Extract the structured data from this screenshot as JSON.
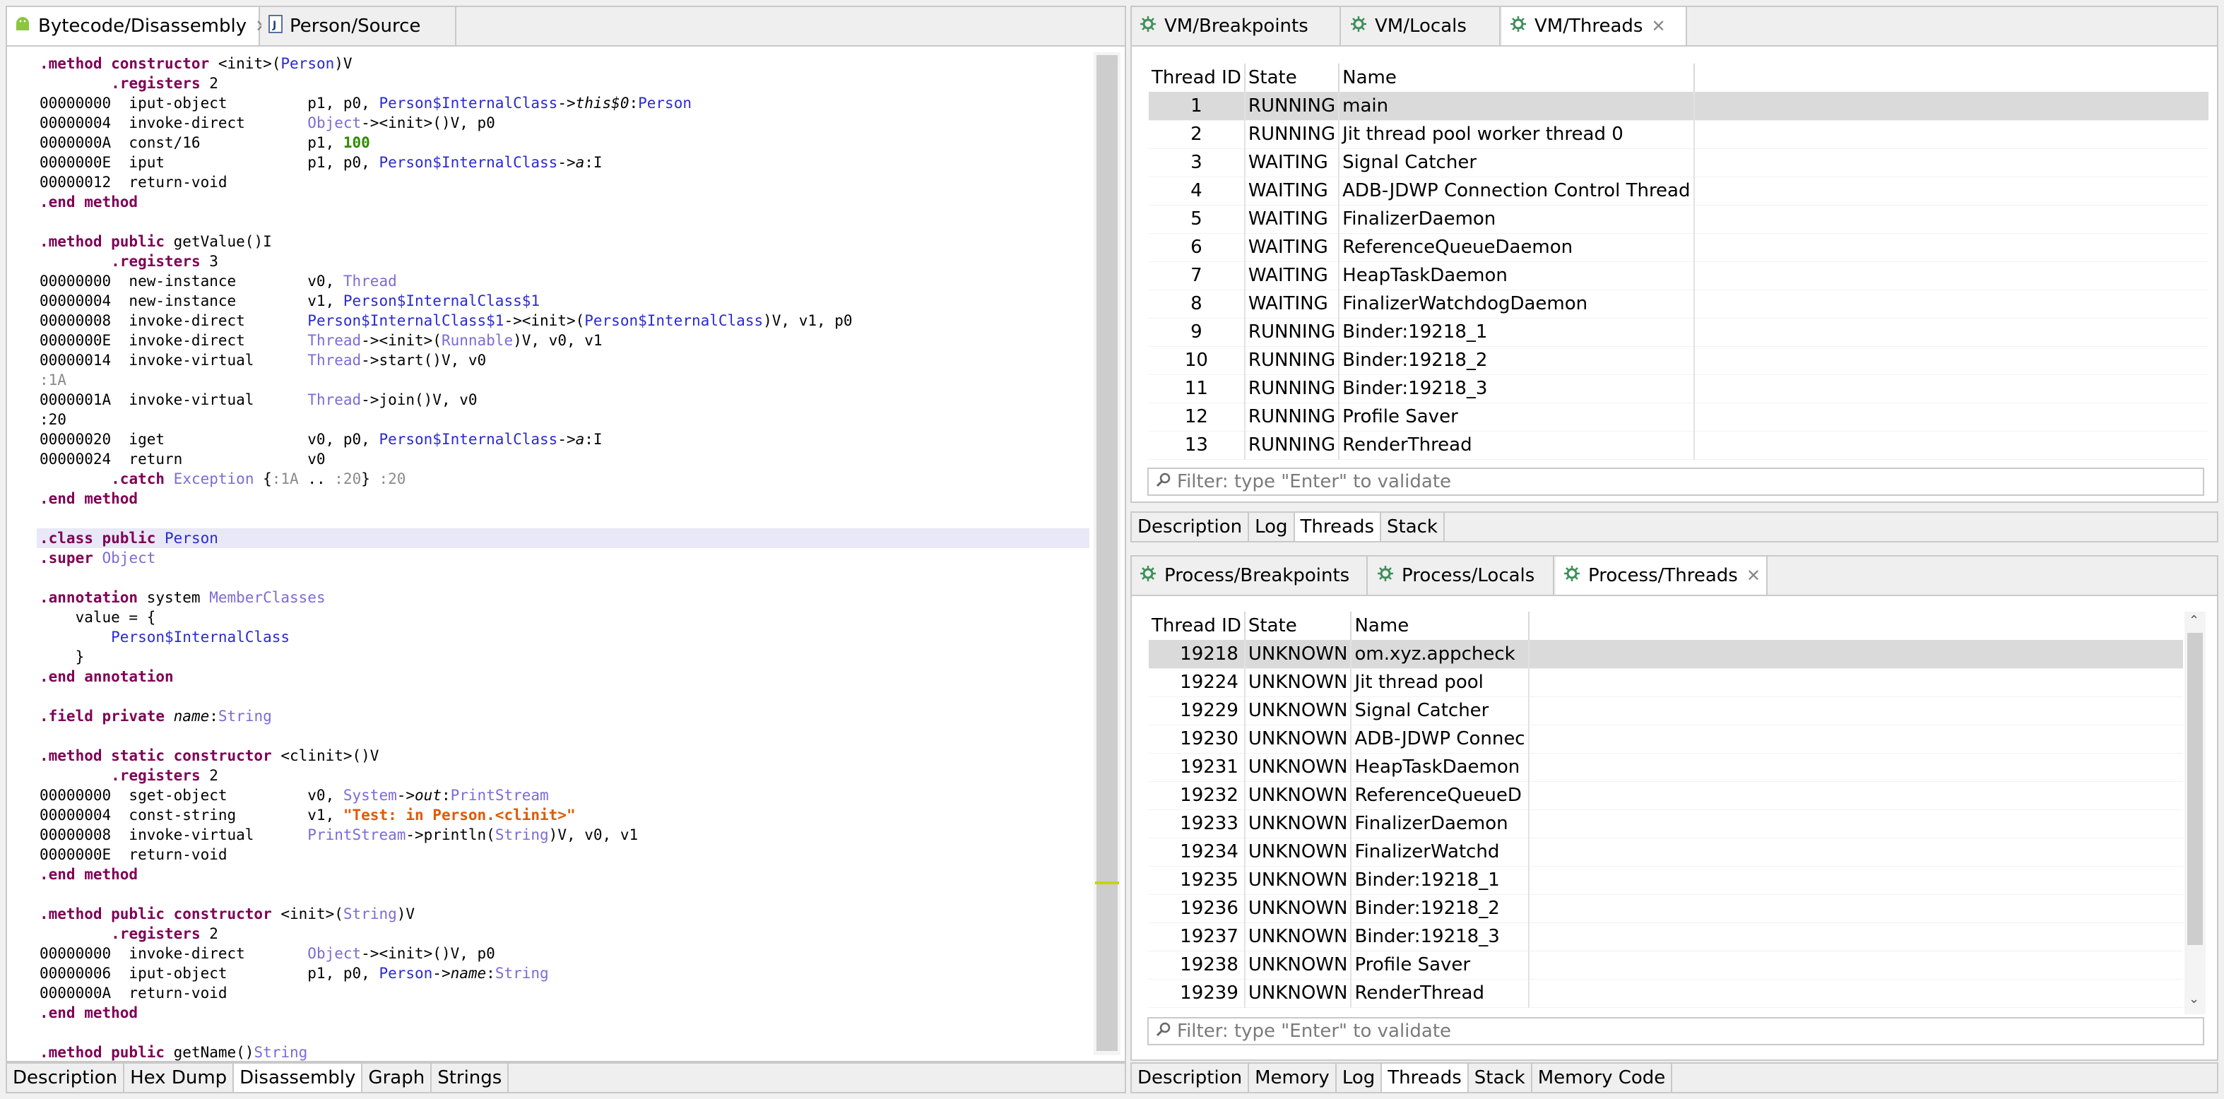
{
  "left": {
    "tabs": [
      {
        "label": "Bytecode/Disassembly",
        "active": true,
        "closable": true,
        "icon": "android-icon"
      },
      {
        "label": "Person/Source",
        "active": false,
        "closable": false,
        "icon": "java-file-icon"
      }
    ],
    "bottom_tabs": [
      "Description",
      "Hex Dump",
      "Disassembly",
      "Graph",
      "Strings"
    ],
    "code_lines": [
      [
        [
          "kw",
          ".method constructor "
        ],
        [
          "",
          "<init>("
        ],
        [
          "ty",
          "Person"
        ],
        [
          "",
          ")V"
        ]
      ],
      [
        [
          "",
          "        "
        ],
        [
          "kw",
          ".registers"
        ],
        [
          "",
          " 2"
        ]
      ],
      [
        [
          "",
          "00000000  iput-object         p1, p0, "
        ],
        [
          "ty",
          "Person$InternalClass"
        ],
        [
          "",
          "->"
        ],
        [
          "it",
          "this$0"
        ],
        [
          "",
          ":"
        ],
        [
          "ty",
          "Person"
        ]
      ],
      [
        [
          "",
          "00000004  invoke-direct       "
        ],
        [
          "tl",
          "Object"
        ],
        [
          "",
          "-><init>()V, p0"
        ]
      ],
      [
        [
          "",
          "0000000A  const/16            p1, "
        ],
        [
          "num",
          "100"
        ]
      ],
      [
        [
          "",
          "0000000E  iput                p1, p0, "
        ],
        [
          "ty",
          "Person$InternalClass"
        ],
        [
          "",
          "->"
        ],
        [
          "it",
          "a"
        ],
        [
          "",
          ":I"
        ]
      ],
      [
        [
          "",
          "00000012  return-void"
        ]
      ],
      [
        [
          "kw",
          ".end method"
        ]
      ],
      [
        [
          "",
          ""
        ]
      ],
      [
        [
          "kw",
          ".method public "
        ],
        [
          "",
          "getValue()I"
        ]
      ],
      [
        [
          "",
          "        "
        ],
        [
          "kw",
          ".registers"
        ],
        [
          "",
          " 3"
        ]
      ],
      [
        [
          "",
          "00000000  new-instance        v0, "
        ],
        [
          "tl",
          "Thread"
        ]
      ],
      [
        [
          "",
          "00000004  new-instance        v1, "
        ],
        [
          "ty",
          "Person$InternalClass$1"
        ]
      ],
      [
        [
          "",
          "00000008  invoke-direct       "
        ],
        [
          "ty",
          "Person$InternalClass$1"
        ],
        [
          "",
          "-><init>("
        ],
        [
          "ty",
          "Person$InternalClass"
        ],
        [
          "",
          ")V, v1, p0"
        ]
      ],
      [
        [
          "",
          "0000000E  invoke-direct       "
        ],
        [
          "tl",
          "Thread"
        ],
        [
          "",
          "-><init>("
        ],
        [
          "tl",
          "Runnable"
        ],
        [
          "",
          ")V, v0, v1"
        ]
      ],
      [
        [
          "",
          "00000014  invoke-virtual      "
        ],
        [
          "tl",
          "Thread"
        ],
        [
          "",
          "->start()V, v0"
        ]
      ],
      [
        [
          "gry",
          ":1A"
        ]
      ],
      [
        [
          "",
          "0000001A  invoke-virtual      "
        ],
        [
          "tl",
          "Thread"
        ],
        [
          "",
          "->join()V, v0"
        ]
      ],
      [
        [
          "",
          ":20"
        ]
      ],
      [
        [
          "",
          "00000020  iget                v0, p0, "
        ],
        [
          "ty",
          "Person$InternalClass"
        ],
        [
          "",
          "->"
        ],
        [
          "it",
          "a"
        ],
        [
          "",
          ":I"
        ]
      ],
      [
        [
          "",
          "00000024  return              v0"
        ]
      ],
      [
        [
          "",
          "        "
        ],
        [
          "kw",
          ".catch"
        ],
        [
          "",
          " "
        ],
        [
          "tl",
          "Exception"
        ],
        [
          "",
          " {"
        ],
        [
          "gry",
          ":1A"
        ],
        [
          "",
          " .. "
        ],
        [
          "gry",
          ":20"
        ],
        [
          "",
          "} "
        ],
        [
          "gry",
          ":20"
        ]
      ],
      [
        [
          "kw",
          ".end method"
        ]
      ],
      [
        [
          "",
          ""
        ]
      ],
      [
        [
          "kw",
          ".class public "
        ],
        [
          "ty",
          "Person"
        ]
      ],
      [
        [
          "kw",
          ".super "
        ],
        [
          "tl",
          "Object"
        ]
      ],
      [
        [
          "",
          ""
        ]
      ],
      [
        [
          "kw",
          ".annotation"
        ],
        [
          "",
          " system "
        ],
        [
          "tl",
          "MemberClasses"
        ]
      ],
      [
        [
          "",
          "    value = {"
        ]
      ],
      [
        [
          "",
          "        "
        ],
        [
          "ty",
          "Person$InternalClass"
        ]
      ],
      [
        [
          "",
          "    }"
        ]
      ],
      [
        [
          "kw",
          ".end annotation"
        ]
      ],
      [
        [
          "",
          ""
        ]
      ],
      [
        [
          "kw",
          ".field private "
        ],
        [
          "it",
          "name"
        ],
        [
          "",
          ":"
        ],
        [
          "tl",
          "String"
        ]
      ],
      [
        [
          "",
          ""
        ]
      ],
      [
        [
          "kw",
          ".method static constructor "
        ],
        [
          "",
          "<clinit>()V"
        ]
      ],
      [
        [
          "",
          "        "
        ],
        [
          "kw",
          ".registers"
        ],
        [
          "",
          " 2"
        ]
      ],
      [
        [
          "",
          "00000000  sget-object         v0, "
        ],
        [
          "tl",
          "System"
        ],
        [
          "",
          "->"
        ],
        [
          "it",
          "out"
        ],
        [
          "",
          ":"
        ],
        [
          "tl",
          "PrintStream"
        ]
      ],
      [
        [
          "",
          "00000004  const-string        v1, "
        ],
        [
          "str",
          "\"Test: in Person.<clinit>\""
        ]
      ],
      [
        [
          "",
          "00000008  invoke-virtual      "
        ],
        [
          "tl",
          "PrintStream"
        ],
        [
          "",
          "->println("
        ],
        [
          "tl",
          "String"
        ],
        [
          "",
          ")V, v0, v1"
        ]
      ],
      [
        [
          "",
          "0000000E  return-void"
        ]
      ],
      [
        [
          "kw",
          ".end method"
        ]
      ],
      [
        [
          "",
          ""
        ]
      ],
      [
        [
          "kw",
          ".method public constructor "
        ],
        [
          "",
          "<init>("
        ],
        [
          "tl",
          "String"
        ],
        [
          "",
          ")V"
        ]
      ],
      [
        [
          "",
          "        "
        ],
        [
          "kw",
          ".registers"
        ],
        [
          "",
          " 2"
        ]
      ],
      [
        [
          "",
          "00000000  invoke-direct       "
        ],
        [
          "tl",
          "Object"
        ],
        [
          "",
          "-><init>()V, p0"
        ]
      ],
      [
        [
          "",
          "00000006  iput-object         p1, p0, "
        ],
        [
          "ty",
          "Person"
        ],
        [
          "",
          "->"
        ],
        [
          "it",
          "name"
        ],
        [
          "",
          ":"
        ],
        [
          "tl",
          "String"
        ]
      ],
      [
        [
          "",
          "0000000A  return-void"
        ]
      ],
      [
        [
          "kw",
          ".end method"
        ]
      ],
      [
        [
          "",
          ""
        ]
      ],
      [
        [
          "kw",
          ".method public "
        ],
        [
          "",
          "getName()"
        ],
        [
          "tl",
          "String"
        ]
      ]
    ]
  },
  "vm": {
    "tabs": [
      {
        "label": "VM/Breakpoints",
        "active": false,
        "closable": false,
        "icon": "debug-gear-icon"
      },
      {
        "label": "VM/Locals",
        "active": false,
        "closable": false,
        "icon": "debug-gear-icon"
      },
      {
        "label": "VM/Threads",
        "active": true,
        "closable": true,
        "icon": "debug-gear-icon"
      }
    ],
    "columns": [
      "Thread ID",
      "State",
      "Name"
    ],
    "rows": [
      [
        "1",
        "RUNNING",
        "main"
      ],
      [
        "2",
        "RUNNING",
        "Jit thread pool worker thread 0"
      ],
      [
        "3",
        "WAITING",
        "Signal Catcher"
      ],
      [
        "4",
        "WAITING",
        "ADB-JDWP Connection Control Thread"
      ],
      [
        "5",
        "WAITING",
        "FinalizerDaemon"
      ],
      [
        "6",
        "WAITING",
        "ReferenceQueueDaemon"
      ],
      [
        "7",
        "WAITING",
        "HeapTaskDaemon"
      ],
      [
        "8",
        "WAITING",
        "FinalizerWatchdogDaemon"
      ],
      [
        "9",
        "RUNNING",
        "Binder:19218_1"
      ],
      [
        "10",
        "RUNNING",
        "Binder:19218_2"
      ],
      [
        "11",
        "RUNNING",
        "Binder:19218_3"
      ],
      [
        "12",
        "RUNNING",
        "Profile Saver"
      ],
      [
        "13",
        "RUNNING",
        "RenderThread"
      ]
    ],
    "filter_placeholder": "Filter: type \"Enter\" to validate",
    "bottom_tabs": [
      "Description",
      "Log",
      "Threads",
      "Stack"
    ]
  },
  "process": {
    "tabs": [
      {
        "label": "Process/Breakpoints",
        "active": false,
        "closable": false,
        "icon": "debug-gear-icon"
      },
      {
        "label": "Process/Locals",
        "active": false,
        "closable": false,
        "icon": "debug-gear-icon"
      },
      {
        "label": "Process/Threads",
        "active": true,
        "closable": true,
        "icon": "debug-gear-icon"
      }
    ],
    "columns": [
      "Thread ID",
      "State",
      "Name"
    ],
    "rows": [
      [
        "19218",
        "UNKNOWN",
        "om.xyz.appcheck"
      ],
      [
        "19224",
        "UNKNOWN",
        "Jit thread pool"
      ],
      [
        "19229",
        "UNKNOWN",
        "Signal Catcher"
      ],
      [
        "19230",
        "UNKNOWN",
        "ADB-JDWP Connec"
      ],
      [
        "19231",
        "UNKNOWN",
        "HeapTaskDaemon"
      ],
      [
        "19232",
        "UNKNOWN",
        "ReferenceQueueD"
      ],
      [
        "19233",
        "UNKNOWN",
        "FinalizerDaemon"
      ],
      [
        "19234",
        "UNKNOWN",
        "FinalizerWatchd"
      ],
      [
        "19235",
        "UNKNOWN",
        "Binder:19218_1"
      ],
      [
        "19236",
        "UNKNOWN",
        "Binder:19218_2"
      ],
      [
        "19237",
        "UNKNOWN",
        "Binder:19218_3"
      ],
      [
        "19238",
        "UNKNOWN",
        "Profile Saver"
      ],
      [
        "19239",
        "UNKNOWN",
        "RenderThread"
      ]
    ],
    "filter_placeholder": "Filter: type \"Enter\" to validate",
    "bottom_tabs": [
      "Description",
      "Memory",
      "Log",
      "Threads",
      "Stack",
      "Memory Code"
    ]
  },
  "colors": {
    "keyword": "#7f0055",
    "type_ref": "#2a2ad0",
    "type_lib": "#7d6bd6",
    "number": "#2e8b00",
    "string": "#e05a00",
    "selected_row": "#dadada",
    "highlight_line": "#e8e8f8",
    "android_green": "#8cc63f",
    "debug_gear": "#3e8e5a"
  }
}
